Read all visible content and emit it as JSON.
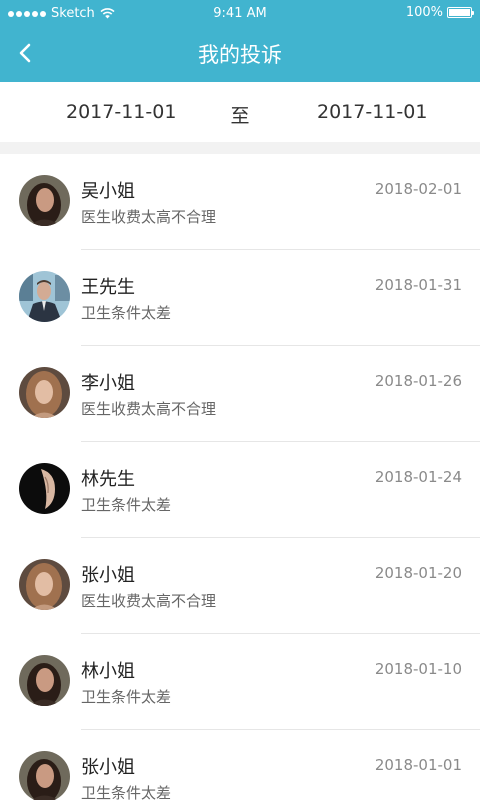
{
  "status_bar": {
    "carrier": "Sketch",
    "time": "9:41 AM",
    "battery": "100%",
    "battery_level": 1.0
  },
  "header": {
    "title": "我的投诉",
    "back_icon": "chevron-left-icon",
    "background": "#41B4CF"
  },
  "date_range": {
    "start": "2017-11-01",
    "separator": "至",
    "end": "2017-11-01"
  },
  "complaints": [
    {
      "name": "吴小姐",
      "reason": "医生收费太高不合理",
      "date": "2018-02-01",
      "avatar": "woman-dark-hair"
    },
    {
      "name": "王先生",
      "reason": "卫生条件太差",
      "date": "2018-01-31",
      "avatar": "man-suit"
    },
    {
      "name": "李小姐",
      "reason": "医生收费太高不合理",
      "date": "2018-01-26",
      "avatar": "woman-light-hair"
    },
    {
      "name": "林先生",
      "reason": "卫生条件太差",
      "date": "2018-01-24",
      "avatar": "man-shadow"
    },
    {
      "name": "张小姐",
      "reason": "医生收费太高不合理",
      "date": "2018-01-20",
      "avatar": "woman-light-hair"
    },
    {
      "name": "林小姐",
      "reason": "卫生条件太差",
      "date": "2018-01-10",
      "avatar": "woman-dark-hair"
    },
    {
      "name": "张小姐",
      "reason": "卫生条件太差",
      "date": "2018-01-01",
      "avatar": "woman-dark-hair"
    }
  ]
}
